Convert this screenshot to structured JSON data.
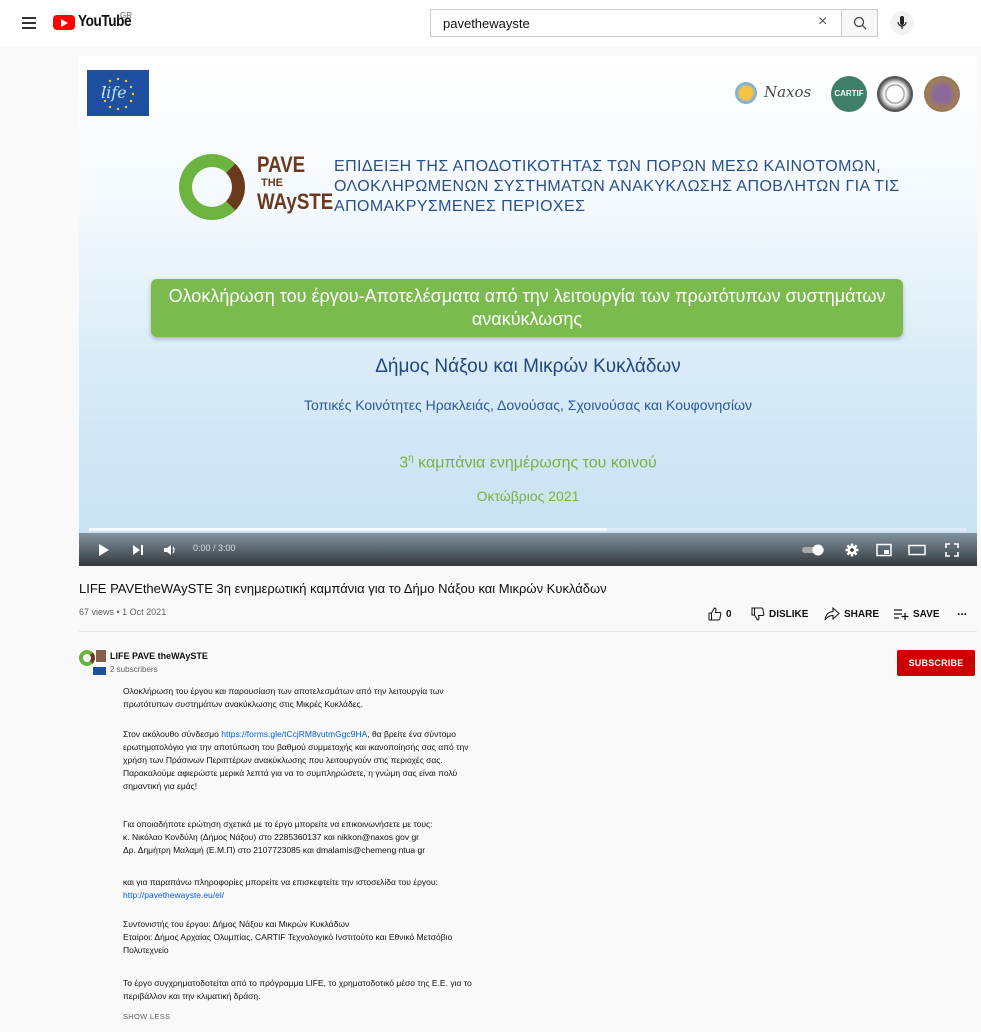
{
  "header": {
    "logo_text": "YouTube",
    "region": "GR",
    "search_value": "pavethewayste",
    "search_placeholder": "Search"
  },
  "slide": {
    "logo_pave": "PAVE",
    "logo_the": "THE",
    "logo_wayste": "WAySTE",
    "naxos": "Naxos",
    "cartif": "CARTIF",
    "eu_life": "life",
    "headline": "ΕΠΙΔΕΙΞΗ ΤΗΣ ΑΠΟΔΟΤΙΚΟΤΗΤΑΣ ΤΩΝ ΠΟΡΩΝ ΜΕΣΩ ΚΑΙΝΟΤΟΜΩΝ, ΟΛΟΚΛΗΡΩΜΕΝΩΝ ΣΥΣΤΗΜΑΤΩΝ ΑΝΑΚΥΚΛΩΣΗΣ ΑΠΟΒΛΗΤΩΝ ΓΙΑ ΤΙΣ ΑΠΟΜΑΚΡΥΣΜΕΝΕΣ ΠΕΡΙΟΧΕΣ",
    "box_text": "Ολοκλήρωση του έργου-Αποτελέσματα από την λειτουργία των πρωτότυπων συστημάτων ανακύκλωσης",
    "municipality": "Δήμος Νάξου και Μικρών Κυκλάδων",
    "communities": "Τοπικές Κοινότητες Ηρακλειάς, Δονούσας, Σχοινούσας και Κουφονησίων",
    "campaign_num": "3",
    "campaign_sup": "η",
    "campaign_rest": " καμπάνια ενημέρωσης του κοινού",
    "date": "Οκτώβριος 2021"
  },
  "player": {
    "time": "0:00 / 3:00",
    "progress_buffered": 0.59
  },
  "video": {
    "title": "LIFE PAVEtheWAySTE 3η ενημερωτική καμπάνια για το Δήμο Νάξου και Μικρών Κυκλάδων",
    "meta": "67 views • 1 Oct 2021",
    "likes": "0",
    "dislike_label": "DISLIKE",
    "share_label": "SHARE",
    "save_label": "SAVE",
    "more_label": "..."
  },
  "channel": {
    "name": "LIFE PAVE theWAySTE",
    "subscribers": "2 subscribers",
    "subscribe_label": "SUBSCRIBE"
  },
  "description": {
    "p1_l1": "Ολοκλήρωση του έργου και παρουσίαση των αποτελεσμάτων από την λειτουργία των",
    "p1_l2": "πρωτότυπων συστημάτων ανακύκλωσης στις Μικρές Κυκλάδες.",
    "p2_pre": "Στον ακόλουθο σύνδεσμο ",
    "p2_link": "https://forms.gle/tCcjRM8vutmGgc9HA",
    "p2_post": ", θα βρείτε ένα σύντομο",
    "p2_l2": "ερωτηματολόγιο για την αποτύπωση του βαθμού συμμετοχής και ικανοποίησής σας από την",
    "p2_l3": "χρήση των Πράσινων Περιπτέρων ανακύκλωσης που λειτουργούν στις περιοχές σας.",
    "p2_l4": "Παρακαλούμε αφιερώστε μερικά λεπτά για να το συμπληρώσετε, η γνώμη σας είναι πολύ",
    "p2_l5": "σημαντική για εμάς!",
    "p3_l1": "Για οποιαδήποτε ερώτηση σχετικά με το έργο μπορείτε να επικοινωνήσετε με τους:",
    "p3_l2": "κ. Νικόλαο Κονδύλη (Δήμος Νάξου) στο 2285360137 και nikkon@naxos gov gr",
    "p3_l3": "Δρ. Δημήτρη Μαλαμή (Ε.Μ.Π) στο 2107723085 και dmalamis@chemeng ntua gr",
    "p4_l1": "και για παραπάνω πληροφορίες μπορείτε να επισκεφτείτε την ιστοσελίδα του έργου:",
    "p4_link": "http://pavethewayste.eu/el/",
    "p5_l1": "Συντονιστής του έργου: Δήμος Νάξου και Μικρών Κυκλάδων",
    "p5_l2": "Εταίροι: Δήμος Αρχαίας Ολυμπίας, CARTIF Τεχνολογικό Ινστιτούτο και Εθνικό Μετσόβιο",
    "p5_l3": "Πολυτεχνείο",
    "p6_l1": "Το έργο συγχρηματοδοτείται από το πρόγραμμα LIFE, το χρηματοδοτικό μέσο της Ε.Ε. για το",
    "p6_l2": "περιβάλλον και την κλιματική δράση.",
    "show_less": "SHOW LESS"
  },
  "colors": {
    "brand_red": "#ff0000",
    "subscribe_red": "#cc0000",
    "link_blue": "#065fd4",
    "slide_green": "#7bbb4e",
    "slide_blue": "#23487c"
  }
}
